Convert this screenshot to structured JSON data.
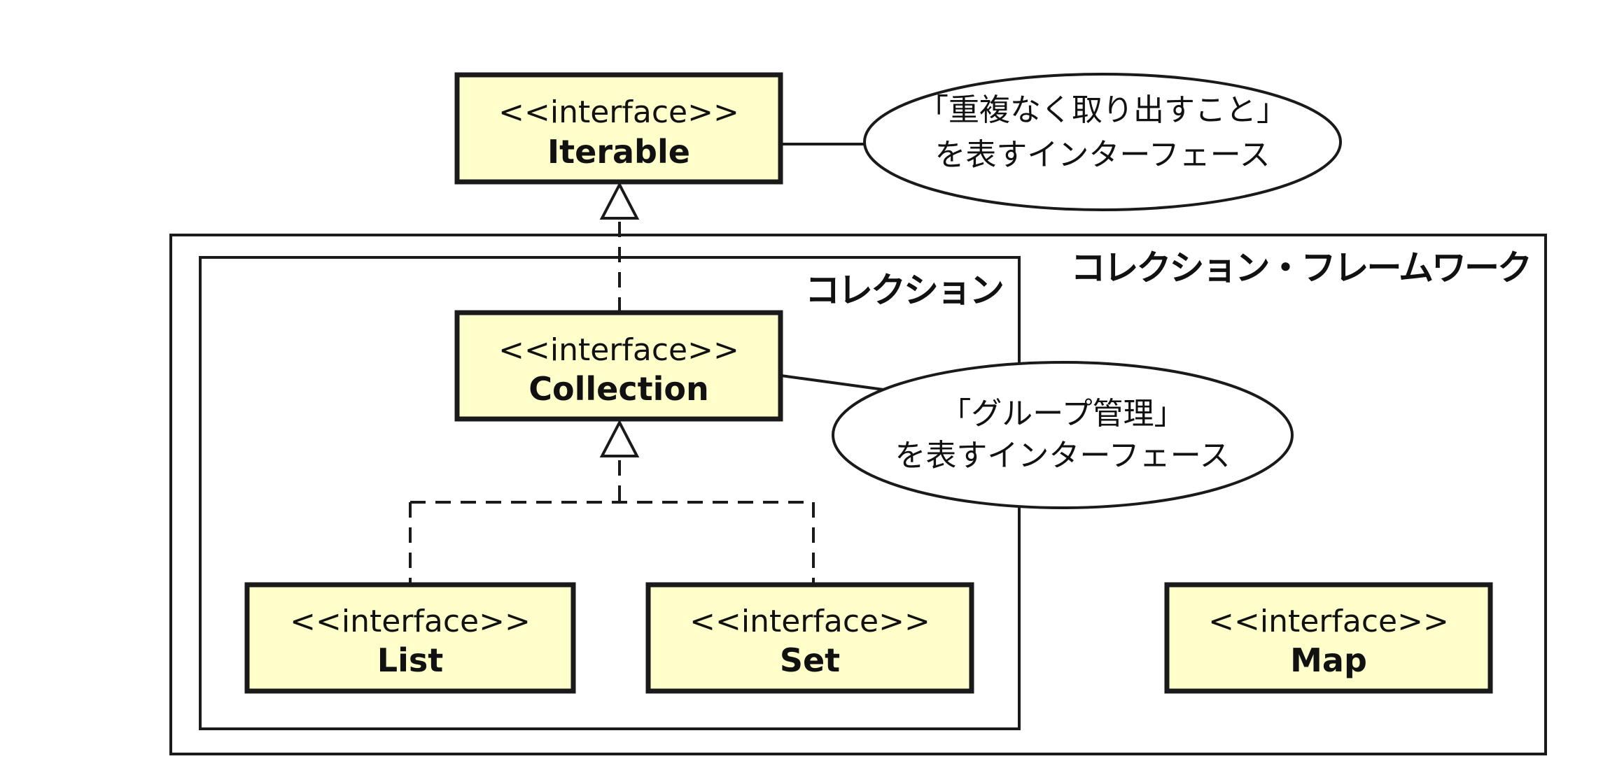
{
  "frames": {
    "framework_label": "コレクション・フレームワーク",
    "collection_label": "コレクション"
  },
  "interfaces": {
    "iterable": {
      "stereotype": "<<interface>>",
      "name": "Iterable"
    },
    "collection": {
      "stereotype": "<<interface>>",
      "name": "Collection"
    },
    "list": {
      "stereotype": "<<interface>>",
      "name": "List"
    },
    "set": {
      "stereotype": "<<interface>>",
      "name": "Set"
    },
    "map": {
      "stereotype": "<<interface>>",
      "name": "Map"
    }
  },
  "notes": {
    "iterable_note": {
      "line1": "「重複なく取り出すこと」",
      "line2": "を表すインターフェース"
    },
    "collection_note": {
      "line1": "「グループ管理」",
      "line2": "を表すインターフェース"
    }
  },
  "colors": {
    "box_fill": "#ffffcc",
    "stroke": "#1a1a1a",
    "background": "#ffffff"
  }
}
